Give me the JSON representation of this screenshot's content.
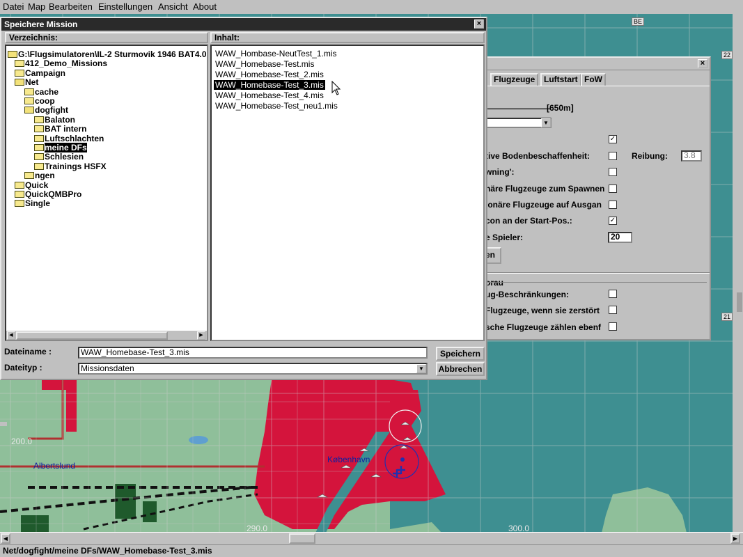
{
  "menubar": {
    "items": [
      "Datei",
      "Map",
      "Bearbeiten",
      "Einstellungen",
      "Ansicht",
      "About"
    ]
  },
  "map": {
    "places": [
      "Albertslund",
      "København"
    ],
    "grid_labels": [
      "200.0",
      "290.0",
      "300.0"
    ],
    "ruler_labels": [
      "BE",
      "22",
      "21"
    ],
    "colors": {
      "sea": "#3e8f91",
      "land": "#8fbf9a",
      "city": "#d4143c",
      "forest": "#1f5a2c",
      "road": "#111111"
    }
  },
  "settings_window": {
    "tabs": [
      "Flugzeuge",
      "Luftstart",
      "FoW"
    ],
    "slider_value": "[650m]",
    "rows": [
      {
        "label": "tive Bodenbeschaffenheit:",
        "checked": false
      },
      {
        "label": "wning':",
        "checked": false
      },
      {
        "label": "näre Flugzeuge zum Spawnen",
        "checked": false
      },
      {
        "label": "ionäre Flugzeuge auf Ausgan",
        "checked": false
      },
      {
        "label": "con an der Start-Pos.:",
        "checked": true
      },
      {
        "label": "e Spieler:",
        "value": "20"
      }
    ],
    "first_check": true,
    "reibung_label": "Reibung:",
    "reibung_value": "3.8",
    "button_label": "zen",
    "group_label": "orau",
    "group_rows": [
      {
        "label": "ug-Beschränkungen:",
        "checked": false
      },
      {
        "label": "Flugzeuge, wenn sie zerstört",
        "checked": false
      },
      {
        "label": "sche Flugzeuge zählen ebenf",
        "checked": false
      }
    ]
  },
  "save_dialog": {
    "title": "Speichere Mission",
    "tree_header": "Verzeichnis:",
    "files_header": "Inhalt:",
    "tree": [
      {
        "label": "G:\\Flugsimulatoren\\IL-2 Sturmovik 1946 BAT4.0",
        "level": 0
      },
      {
        "label": "412_Demo_Missions",
        "level": 1
      },
      {
        "label": "Campaign",
        "level": 1
      },
      {
        "label": "Net",
        "level": 1
      },
      {
        "label": "cache",
        "level": 2
      },
      {
        "label": "coop",
        "level": 2
      },
      {
        "label": "dogfight",
        "level": 2
      },
      {
        "label": "Balaton",
        "level": 3
      },
      {
        "label": "BAT intern",
        "level": 3
      },
      {
        "label": "Luftschlachten",
        "level": 3
      },
      {
        "label": "meine DFs",
        "level": 3,
        "selected": true
      },
      {
        "label": "Schlesien",
        "level": 3
      },
      {
        "label": "Trainings HSFX",
        "level": 3
      },
      {
        "label": "ngen",
        "level": 2
      },
      {
        "label": "Quick",
        "level": 1
      },
      {
        "label": "QuickQMBPro",
        "level": 1
      },
      {
        "label": "Single",
        "level": 1
      }
    ],
    "files": [
      "WAW_Hombase-NeutTest_1.mis",
      "WAW_Homebase-Test.mis",
      "WAW_Homebase-Test_2.mis",
      "WAW_Homebase-Test_3.mis",
      "WAW_Homebase-Test_4.mis",
      "WAW_Homebase-Test_neu1.mis"
    ],
    "selected_file_index": 3,
    "filename_label": "Dateiname :",
    "filename_value": "WAW_Homebase-Test_3.mis",
    "filetype_label": "Dateityp :",
    "filetype_value": "Missionsdaten",
    "save_button": "Speichern",
    "cancel_button": "Abbrechen"
  },
  "status_bar": {
    "path": "Net/dogfight/meine DFs/WAW_Homebase-Test_3.mis"
  }
}
